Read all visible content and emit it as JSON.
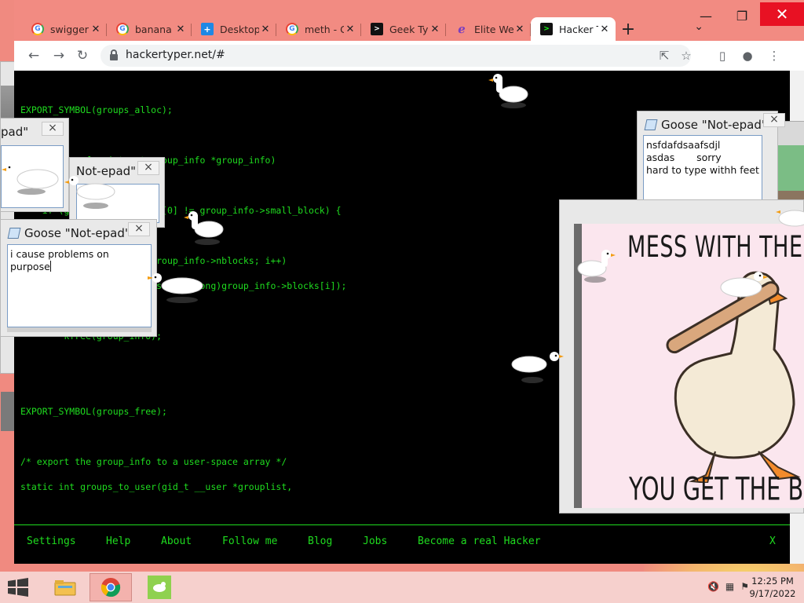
{
  "browser": {
    "tabs": [
      {
        "label": "swigger",
        "favicon": "google-g-icon"
      },
      {
        "label": "banana",
        "favicon": "google-g-icon"
      },
      {
        "label": "Desktop",
        "favicon": "desktop-app-icon"
      },
      {
        "label": "meth - G",
        "favicon": "google-g-icon"
      },
      {
        "label": "Geek Ty",
        "favicon": "terminal-icon"
      },
      {
        "label": "Elite We",
        "favicon": "elite-icon"
      },
      {
        "label": "Hacker T",
        "favicon": "hacker-icon",
        "active": true
      }
    ],
    "url": "hackertyper.net/#",
    "accent_color": "#f28b82"
  },
  "page": {
    "code_lines": [
      "EXPORT_SYMBOL(groups_alloc);",
      "void groups_free(struct group_info *group_info)",
      "\tif (group_info->blocks[0] != group_info->small_block) {",
      "\t\tfor (i = 0; i < group_info->nblocks; i++)",
      "\t\t\tfree_page((unsigned long)group_info->blocks[i]);",
      "\tkfree(group_info);",
      "EXPORT_SYMBOL(groups_free);",
      "/* export the group_info to a user-space array */",
      "static int groups_to_user(gid_t __user *grouplist,"
    ],
    "footer_links": [
      "Settings",
      "Help",
      "About",
      "Follow me",
      "Blog",
      "Jobs",
      "Become a real Hacker"
    ],
    "footer_close": "X",
    "text_color": "#1fdc1f"
  },
  "notepads": {
    "main": {
      "title": "Goose \"Not-epad\"",
      "text": "i cause problems on purpose"
    },
    "second": {
      "title": "Not-epad\""
    },
    "third": {
      "title": "pad\""
    },
    "right": {
      "title": "Goose \"Not-epad\"",
      "lines": [
        "nsfdafdsaafsdjl",
        "asdas       sorry",
        "hard to type withh feet"
      ]
    }
  },
  "meme": {
    "top_text": "MESS WITH THE",
    "bottom_text": "YOU GET THE BONK"
  },
  "taskbar": {
    "time": "12:25 PM",
    "date": "9/17/2022"
  }
}
